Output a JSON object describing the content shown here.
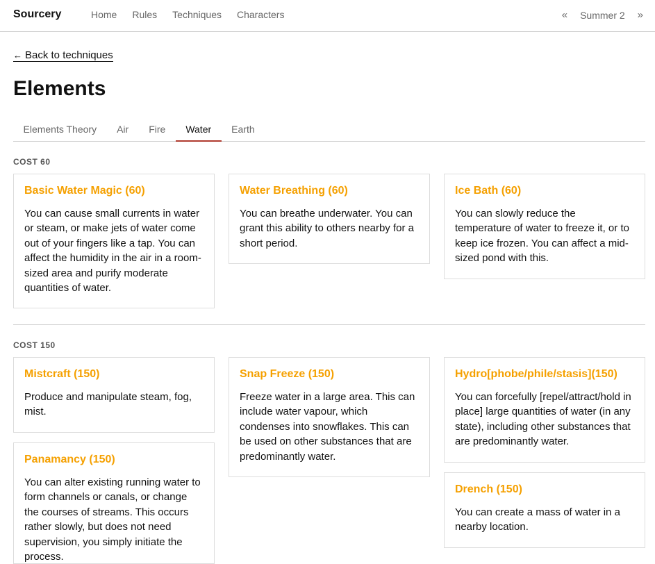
{
  "header": {
    "brand": "Sourcery",
    "nav": [
      "Home",
      "Rules",
      "Techniques",
      "Characters"
    ],
    "season_prev": "«",
    "season_label": "Summer 2",
    "season_next": "»"
  },
  "back_link": {
    "arrow": "←",
    "label": "Back to techniques"
  },
  "page_title": "Elements",
  "tabs": [
    {
      "label": "Elements Theory",
      "active": false
    },
    {
      "label": "Air",
      "active": false
    },
    {
      "label": "Fire",
      "active": false
    },
    {
      "label": "Water",
      "active": true
    },
    {
      "label": "Earth",
      "active": false
    }
  ],
  "sections": [
    {
      "label": "COST 60",
      "cards": [
        {
          "title": "Basic Water Magic (60)",
          "desc": "You can cause small currents in water or steam, or make jets of water come out of your fingers like a tap. You can affect the humidity in the air in a room-sized area and purify moderate quantities of water."
        },
        {
          "title": "Water Breathing (60)",
          "desc": "You can breathe underwater. You can grant this ability to others nearby for a short period."
        },
        {
          "title": "Ice Bath (60)",
          "desc": "You can slowly reduce the temperature of water to freeze it, or to keep ice frozen. You can affect a mid-sized pond with this."
        }
      ]
    },
    {
      "label": "COST 150",
      "cards": [
        {
          "title": "Mistcraft (150)",
          "desc": "Produce and manipulate steam, fog, mist."
        },
        {
          "title": "Snap Freeze (150)",
          "desc": "Freeze water in a large area. This can include water vapour, which condenses into snowflakes. This can be used on other substances that are predominantly water."
        },
        {
          "title": "Hydro[phobe/phile/stasis](150)",
          "desc": "You can forcefully [repel/attract/hold in place] large quantities of water (in any state), including other substances that are predominantly water."
        },
        {
          "title": "Panamancy (150)",
          "desc": "You can alter existing running water to form channels or canals, or change the courses of streams. This occurs rather slowly, but does not need supervision, you simply initiate the process."
        },
        {
          "title": "Drench (150)",
          "desc": "You can create a mass of water in a nearby location."
        }
      ]
    }
  ],
  "colors": {
    "accent_title": "#f5a000",
    "active_tab_underline": "#b03a2e"
  }
}
